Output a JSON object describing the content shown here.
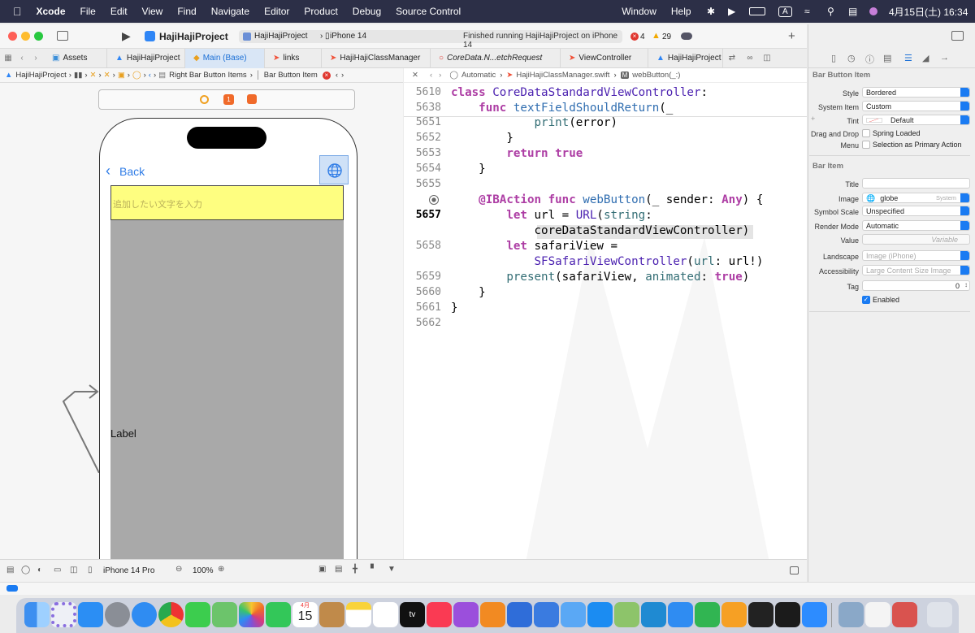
{
  "menubar": {
    "app": "Xcode",
    "items": [
      "File",
      "Edit",
      "View",
      "Find",
      "Navigate",
      "Editor",
      "Product",
      "Debug",
      "Source Control",
      "Window",
      "Help"
    ],
    "input_mode": "A",
    "datetime": "4月15日(土) 16:34"
  },
  "toolbar": {
    "project": "HajiHajiProject",
    "scheme": "HajiHajiProject",
    "device": "iPhone 14",
    "status": "Finished running HajiHajiProject on iPhone 14",
    "errors": "4",
    "warnings": "29"
  },
  "tabs": [
    {
      "label": "Assets",
      "active": false
    },
    {
      "label": "HajiHajiProject",
      "active": false
    },
    {
      "label": "Main (Base)",
      "active": true
    },
    {
      "label": "links",
      "active": false
    },
    {
      "label": "HajiHajiClassManager",
      "active": false
    },
    {
      "label": "CoreData.N...etchRequest",
      "active": false
    },
    {
      "label": "ViewController",
      "active": false
    },
    {
      "label": "HajiHajiProject",
      "active": false
    }
  ],
  "left_jumpbar": {
    "project": "HajiHajiProject",
    "item1": "Right Bar Button Items",
    "item2": "Bar Button Item"
  },
  "right_jumpbar": {
    "mode": "Automatic",
    "file": "HajiHajiClassManager.swift",
    "symbol_badge": "M",
    "symbol": "webButton(_:)"
  },
  "canvas": {
    "badge_number": "1",
    "back_label": "Back",
    "textfield_placeholder": "追加したい文字を入力",
    "label_text": "Label"
  },
  "code_lines": [
    {
      "num": "5610",
      "current": false,
      "sticky": true,
      "parts": [
        [
          "kw",
          "class "
        ],
        [
          "ty",
          "CoreDataStandardViewController"
        ],
        [
          "pl",
          ":"
        ]
      ]
    },
    {
      "num": "5638",
      "current": false,
      "sticky": true,
      "parts": [
        [
          "pl",
          "    "
        ],
        [
          "kw",
          "func "
        ],
        [
          "fn",
          "textFieldShouldReturn"
        ],
        [
          "pl",
          "(_"
        ]
      ]
    },
    {
      "num": "5651",
      "current": false,
      "sticky": false,
      "parts": [
        [
          "pl",
          "            "
        ],
        [
          "tf",
          "print"
        ],
        [
          "pl",
          "(error)"
        ]
      ]
    },
    {
      "num": "5652",
      "current": false,
      "sticky": false,
      "parts": [
        [
          "pl",
          "        }"
        ]
      ]
    },
    {
      "num": "5653",
      "current": false,
      "sticky": false,
      "parts": [
        [
          "pl",
          "        "
        ],
        [
          "kw",
          "return true"
        ]
      ]
    },
    {
      "num": "5654",
      "current": false,
      "sticky": false,
      "parts": [
        [
          "pl",
          "    }"
        ]
      ]
    },
    {
      "num": "5655",
      "current": false,
      "sticky": false,
      "parts": [
        [
          "pl",
          ""
        ]
      ]
    },
    {
      "num": "",
      "current": false,
      "sticky": false,
      "parts": [
        [
          "pl",
          "    "
        ],
        [
          "kw",
          "@IBAction func "
        ],
        [
          "fn",
          "webButton"
        ],
        [
          "pl",
          "(_ sender: "
        ],
        [
          "kw",
          "Any"
        ],
        [
          "pl",
          ") {"
        ]
      ]
    },
    {
      "num": "5657",
      "current": true,
      "sticky": false,
      "parts": [
        [
          "pl",
          "        "
        ],
        [
          "kw",
          "let "
        ],
        [
          "pl",
          "url = "
        ],
        [
          "ty",
          "URL"
        ],
        [
          "pl",
          "("
        ],
        [
          "tf",
          "string"
        ],
        [
          "pl",
          ":"
        ]
      ]
    },
    {
      "num": "",
      "current": false,
      "sticky": false,
      "parts": [
        [
          "pl",
          "            coreDataStandardViewController)"
        ]
      ]
    },
    {
      "num": "5658",
      "current": false,
      "sticky": false,
      "parts": [
        [
          "pl",
          "        "
        ],
        [
          "kw",
          "let "
        ],
        [
          "pl",
          "safariView ="
        ]
      ]
    },
    {
      "num": "",
      "current": false,
      "sticky": false,
      "parts": [
        [
          "pl",
          "            "
        ],
        [
          "ty",
          "SFSafariViewController"
        ],
        [
          "pl",
          "("
        ],
        [
          "tf",
          "url"
        ],
        [
          "pl",
          ": url!)"
        ]
      ]
    },
    {
      "num": "5659",
      "current": false,
      "sticky": false,
      "parts": [
        [
          "pl",
          "        "
        ],
        [
          "tf",
          "present"
        ],
        [
          "pl",
          "(safariView, "
        ],
        [
          "tf",
          "animated"
        ],
        [
          "pl",
          ": "
        ],
        [
          "kw",
          "true"
        ],
        [
          "pl",
          ")"
        ]
      ]
    },
    {
      "num": "5660",
      "current": false,
      "sticky": false,
      "parts": [
        [
          "pl",
          "    }"
        ]
      ]
    },
    {
      "num": "5661",
      "current": false,
      "sticky": false,
      "parts": [
        [
          "pl",
          "}"
        ]
      ]
    },
    {
      "num": "5662",
      "current": false,
      "sticky": false,
      "parts": [
        [
          "pl",
          ""
        ]
      ]
    }
  ],
  "inspector": {
    "section1": "Bar Button Item",
    "style_label": "Style",
    "style_value": "Bordered",
    "system_item_label": "System Item",
    "system_item_value": "Custom",
    "tint_label": "Tint",
    "tint_value": "Default",
    "dnd_label": "Drag and Drop",
    "dnd_value": "Spring Loaded",
    "menu_label": "Menu",
    "menu_value": "Selection as Primary Action",
    "section2": "Bar Item",
    "title_label": "Title",
    "title_value": "",
    "image_label": "Image",
    "image_value": "globe",
    "image_tag": "System",
    "symbol_scale_label": "Symbol Scale",
    "symbol_scale_value": "Unspecified",
    "render_mode_label": "Render Mode",
    "render_mode_value": "Automatic",
    "value_label": "Value",
    "value_placeholder": "Variable",
    "landscape_label": "Landscape",
    "landscape_placeholder": "Image (iPhone)",
    "accessibility_label": "Accessibility",
    "accessibility_placeholder": "Large Content Size Image",
    "tag_label": "Tag",
    "tag_value": "0",
    "enabled_label": "Enabled"
  },
  "bottombar": {
    "device": "iPhone 14 Pro",
    "zoom": "100%"
  },
  "dock": {
    "calendar_month": "4月",
    "calendar_day": "15",
    "appletv_label": "tv"
  }
}
